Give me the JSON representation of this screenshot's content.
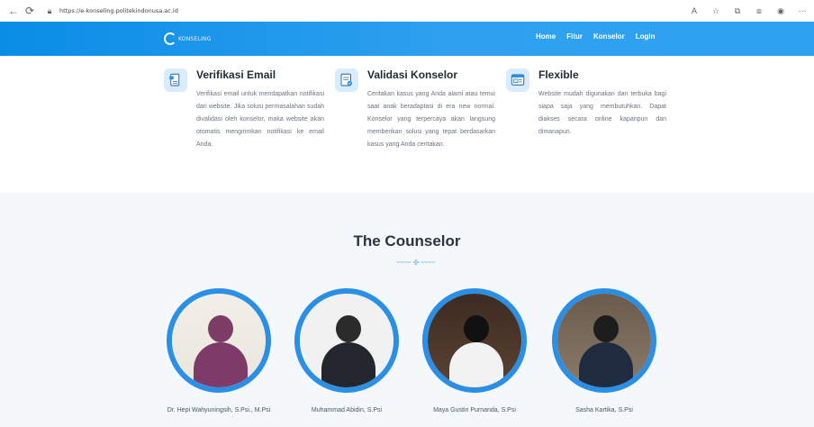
{
  "browser": {
    "url": "https://e-konseling.politekindonusa.ac.id",
    "icons": [
      "back-icon",
      "reload-icon",
      "lock-icon",
      "reader-icon",
      "favorite-icon",
      "collections-icon",
      "extensions-icon",
      "profile-icon",
      "more-icon"
    ]
  },
  "header": {
    "logo_text": "KONSELING",
    "nav": [
      "Home",
      "Fitur",
      "Konselor",
      "Login"
    ]
  },
  "features": [
    {
      "icon": "email-doc-icon",
      "title": "Verifikasi Email",
      "text": "Verifikasi email untuk mendapatkan notifikasi dari website. Jika solusi permasalahan sudah divalidasi oleh konselor, maka website akan otomatis mengirimkan notifikasi ke email Anda."
    },
    {
      "icon": "validation-doc-icon",
      "title": "Validasi Konselor",
      "text": "Ceritakan kasus yang Anda alami atau temui saat anak beradaptasi di era new normal. Konselor yang terpercaya akan langsung memberikan solusi yang tepat berdasarkan kasus yang Anda ceritakan."
    },
    {
      "icon": "browser-window-icon",
      "title": "Flexible",
      "text": "Website mudah digunakan dan terbuka bagi siapa saja yang membutuhkan. Dapat diakses secara online kapanpun dan dimanapun."
    }
  ],
  "counselor_section": {
    "title": "The Counselor",
    "divider": "〰〰 ✣ 〰〰",
    "counselors": [
      {
        "name": "Dr. Hepi Wahyuningsih, S.Psi., M.Psi"
      },
      {
        "name": "Muhammad Abidin, S.Psi"
      },
      {
        "name": "Maya Gustin Purnanda, S.Psi"
      },
      {
        "name": "Sasha Kartika, S.Psi"
      }
    ]
  },
  "colors": {
    "header_start": "#0a8de6",
    "header_end": "#2da3f0",
    "accent": "#2b8fe6",
    "section_bg": "#f4f8fb"
  }
}
